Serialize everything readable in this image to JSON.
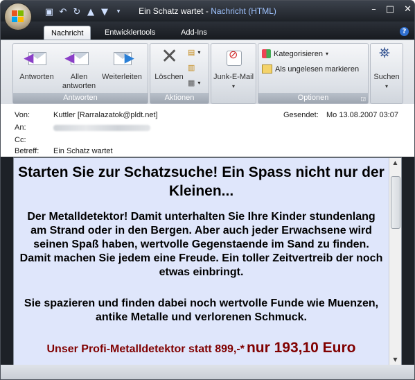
{
  "window": {
    "title_subject": "Ein Schatz wartet",
    "title_separator": "-",
    "title_app": "Nachricht (HTML)"
  },
  "tabs": [
    {
      "label": "Nachricht",
      "active": true
    },
    {
      "label": "Entwicklertools",
      "active": false
    },
    {
      "label": "Add-Ins",
      "active": false
    }
  ],
  "ribbon": {
    "groups": {
      "antworten": {
        "label": "Antworten",
        "buttons": [
          "Antworten",
          "Allen antworten",
          "Weiterleiten"
        ]
      },
      "aktionen": {
        "label": "Aktionen",
        "delete_label": "Löschen"
      },
      "junk": {
        "label": "Junk-E-Mail"
      },
      "optionen": {
        "label": "Optionen",
        "categorize": "Kategorisieren",
        "mark_unread": "Als ungelesen markieren"
      },
      "suchen": {
        "label": "Suchen"
      }
    }
  },
  "header": {
    "from_label": "Von:",
    "from_value": "Kuttler [Rarralazatok@pldt.net]",
    "to_label": "An:",
    "cc_label": "Cc:",
    "subject_label": "Betreff:",
    "subject_value": "Ein Schatz wartet",
    "sent_label": "Gesendet:",
    "sent_value": "Mo 13.08.2007 03:07"
  },
  "body": {
    "heading": "Starten Sie zur Schatzsuche! Ein Spass nicht nur der Kleinen...",
    "paragraph1": "Der Metalldetektor! Damit unterhalten Sie Ihre Kinder stundenlang am Strand oder in den Bergen. Aber auch jeder Erwachsene wird seinen Spaß haben, wertvolle Gegenstaende im Sand zu finden. Damit machen Sie jedem eine Freude. Ein toller Zeitvertreib der noch etwas einbringt.",
    "paragraph2": "Sie spazieren und finden dabei noch wertvolle Funde wie Muenzen, antike Metalle und verlorenen Schmuck.",
    "offer_prefix": "Unser Profi-Metalldetektor statt 899,-*",
    "offer_price": "nur 193,10 Euro"
  },
  "colors": {
    "body_bg": "#dfe6fb",
    "offer": "#800000",
    "title_app": "#9fc3ff"
  }
}
